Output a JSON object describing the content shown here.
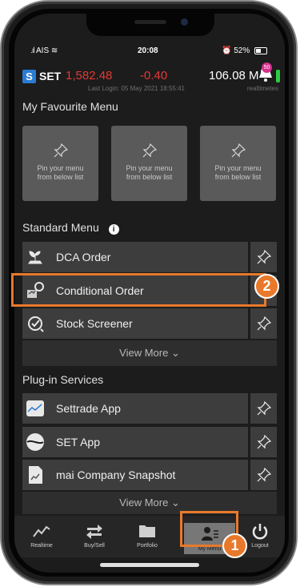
{
  "status_bar": {
    "carrier": "AIS",
    "time": "20:08",
    "battery": "52%"
  },
  "ticker": {
    "logo_text": "SET",
    "index_value": "1,582.48",
    "change": "-0.40",
    "volume": "106.08 M",
    "last_login": "Last Login: 05 May 2021 18:55:41",
    "realtime_label": "realtimetes",
    "notification_count": "50",
    "colors": {
      "down": "#e53935",
      "accent": "#2a7bd4"
    }
  },
  "favourite": {
    "title": "My Favourite Menu",
    "cards": [
      {
        "line1": "Pin your menu",
        "line2": "from below list",
        "icon": "pin-icon"
      },
      {
        "line1": "Pin your menu",
        "line2": "from below list",
        "icon": "pin-icon"
      },
      {
        "line1": "Pin your menu",
        "line2": "from below list",
        "icon": "pin-icon"
      }
    ]
  },
  "standard_menu": {
    "title": "Standard Menu",
    "info_icon": "info-icon",
    "items": [
      {
        "label": "DCA Order",
        "icon": "plant-icon"
      },
      {
        "label": "Conditional Order",
        "icon": "conditional-order-icon"
      },
      {
        "label": "Stock Screener",
        "icon": "screener-icon"
      }
    ],
    "view_more": "View More"
  },
  "plugins": {
    "title": "Plug-in Services",
    "items": [
      {
        "label": "Settrade App",
        "icon": "settrade-app-icon"
      },
      {
        "label": "SET App",
        "icon": "set-app-icon"
      },
      {
        "label": "mai Company Snapshot",
        "icon": "mai-snapshot-icon"
      }
    ],
    "view_more": "View More"
  },
  "tabs": [
    {
      "label": "Realtime",
      "icon": "chart-line-icon"
    },
    {
      "label": "Buy/Sell",
      "icon": "buy-sell-icon"
    },
    {
      "label": "Portfolio",
      "icon": "folder-icon"
    },
    {
      "label": "My Menu",
      "icon": "user-menu-icon",
      "active": true
    },
    {
      "label": "Logout",
      "icon": "power-icon"
    }
  ],
  "annotations": {
    "step1": "1",
    "step2": "2",
    "highlight_color": "#e8792b"
  }
}
